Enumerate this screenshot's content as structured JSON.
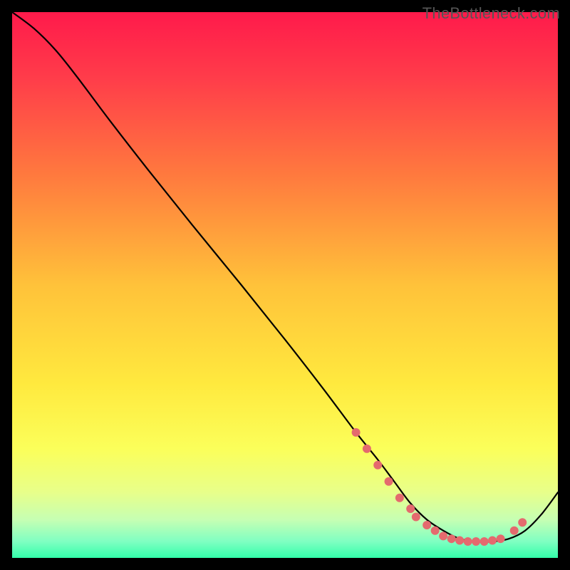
{
  "watermark": "TheBottleneck.com",
  "chart_data": {
    "type": "line",
    "title": "",
    "xlabel": "",
    "ylabel": "",
    "xlim": [
      0,
      100
    ],
    "ylim": [
      0,
      100
    ],
    "gradient_stops": [
      {
        "offset": 0.0,
        "color": "#ff1a4b"
      },
      {
        "offset": 0.12,
        "color": "#ff3c4a"
      },
      {
        "offset": 0.3,
        "color": "#ff7a3e"
      },
      {
        "offset": 0.5,
        "color": "#ffc23a"
      },
      {
        "offset": 0.68,
        "color": "#ffe93e"
      },
      {
        "offset": 0.8,
        "color": "#fbff5a"
      },
      {
        "offset": 0.88,
        "color": "#e8ff8a"
      },
      {
        "offset": 0.93,
        "color": "#c6ffb3"
      },
      {
        "offset": 0.97,
        "color": "#7fffc2"
      },
      {
        "offset": 1.0,
        "color": "#33ffaa"
      }
    ],
    "series": [
      {
        "name": "bottleneck-curve",
        "x": [
          0,
          4,
          8,
          12,
          18,
          25,
          33,
          42,
          50,
          57,
          63,
          67,
          70,
          73,
          76,
          79,
          82,
          85,
          88,
          91,
          94,
          97,
          100
        ],
        "y": [
          100,
          97,
          93,
          88,
          80,
          71,
          61,
          50,
          40,
          31,
          23,
          18,
          14,
          10,
          7,
          5,
          3.5,
          3,
          3,
          3.5,
          5,
          8,
          12
        ]
      }
    ],
    "markers": {
      "name": "highlight-points",
      "color": "#e46a6e",
      "radius": 6,
      "points": [
        {
          "x": 63,
          "y": 23
        },
        {
          "x": 65,
          "y": 20
        },
        {
          "x": 67,
          "y": 17
        },
        {
          "x": 69,
          "y": 14
        },
        {
          "x": 71,
          "y": 11
        },
        {
          "x": 73,
          "y": 9
        },
        {
          "x": 74,
          "y": 7.5
        },
        {
          "x": 76,
          "y": 6
        },
        {
          "x": 77.5,
          "y": 5
        },
        {
          "x": 79,
          "y": 4
        },
        {
          "x": 80.5,
          "y": 3.5
        },
        {
          "x": 82,
          "y": 3.2
        },
        {
          "x": 83.5,
          "y": 3
        },
        {
          "x": 85,
          "y": 3
        },
        {
          "x": 86.5,
          "y": 3
        },
        {
          "x": 88,
          "y": 3.2
        },
        {
          "x": 89.5,
          "y": 3.5
        },
        {
          "x": 92,
          "y": 5
        },
        {
          "x": 93.5,
          "y": 6.5
        }
      ]
    }
  }
}
